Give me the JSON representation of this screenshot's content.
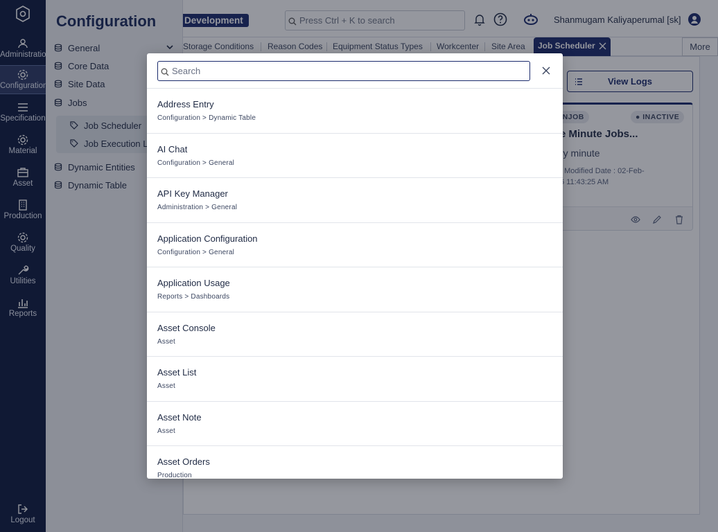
{
  "rail": {
    "items": [
      {
        "label": "Administration",
        "icon": "users-icon"
      },
      {
        "label": "Configuration",
        "icon": "gear-icon"
      },
      {
        "label": "Specification",
        "icon": "list-icon"
      },
      {
        "label": "Material",
        "icon": "gear-icon"
      },
      {
        "label": "Asset",
        "icon": "briefcase-icon"
      },
      {
        "label": "Production",
        "icon": "building-icon"
      },
      {
        "label": "Quality",
        "icon": "gear-icon"
      },
      {
        "label": "Utilities",
        "icon": "wrench-icon"
      },
      {
        "label": "Reports",
        "icon": "bar-chart-icon"
      }
    ],
    "logout": "Logout"
  },
  "sidenav": {
    "title": "Configuration",
    "items": [
      "General",
      "Core Data",
      "Site Data",
      "Jobs"
    ],
    "sub_items": [
      "Job Scheduler",
      "Job Execution Log"
    ],
    "items_after": [
      "Dynamic Entities",
      "Dynamic Table"
    ]
  },
  "topbar": {
    "environment": "Development",
    "search_placeholder": "Press Ctrl + K to search",
    "user_name": "Shanmugam Kaliyaperumal [sk]"
  },
  "tabs": {
    "items": [
      "Storage Conditions",
      "Reason Codes",
      "Equipment Status Types",
      "Workcenter",
      "Site Area"
    ],
    "active": "Job Scheduler",
    "more": "More"
  },
  "content": {
    "view_logs": "View Logs",
    "card": {
      "type_chip": "MINJOB",
      "status_chip": "INACTIVE",
      "title": "e Minute Jobs...",
      "subtitle": "ry minute",
      "meta_line1": ": Modified Date : 02-Feb-",
      "meta_line2": "6 11:43:25 AM"
    }
  },
  "modal": {
    "search_placeholder": "Search",
    "results": [
      {
        "title": "Address Entry",
        "path": "Configuration > Dynamic Table"
      },
      {
        "title": "AI Chat",
        "path": "Configuration > General"
      },
      {
        "title": "API Key Manager",
        "path": "Administration > General"
      },
      {
        "title": "Application Configuration",
        "path": "Configuration > General"
      },
      {
        "title": "Application Usage",
        "path": "Reports > Dashboards"
      },
      {
        "title": "Asset Console",
        "path": "Asset"
      },
      {
        "title": "Asset List",
        "path": "Asset"
      },
      {
        "title": "Asset Note",
        "path": "Asset"
      },
      {
        "title": "Asset Orders",
        "path": "Production"
      }
    ]
  },
  "colors": {
    "rail_bg": "#0e1a3e",
    "brand": "#1a2a6c",
    "overlay": "rgba(20,25,40,0.45)"
  }
}
